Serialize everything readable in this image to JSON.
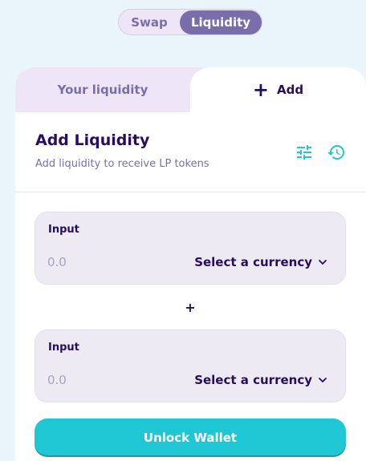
{
  "nav_toggle": {
    "items": [
      {
        "label": "Swap",
        "active": false
      },
      {
        "label": "Liquidity",
        "active": true
      }
    ]
  },
  "tabs": {
    "your_liquidity": "Your liquidity",
    "add": "Add",
    "add_icon": "plus-icon",
    "active": "add"
  },
  "header": {
    "title": "Add Liquidity",
    "subtitle": "Add liquidity to receive LP tokens",
    "icons": [
      "settings-sliders-icon",
      "history-icon"
    ]
  },
  "inputs": [
    {
      "label": "Input",
      "placeholder": "0.0",
      "value": "",
      "currency": "Select a currency"
    },
    {
      "label": "Input",
      "placeholder": "0.0",
      "value": "",
      "currency": "Select a currency"
    }
  ],
  "separator": "+",
  "action_button": {
    "label": "Unlock Wallet"
  },
  "colors": {
    "primary": "#1fc7d4",
    "secondary": "#7a6eaa",
    "text": "#280d5f",
    "background": "#e9f5fb",
    "tertiary": "#eee6f7",
    "input": "#eeeaf4"
  }
}
